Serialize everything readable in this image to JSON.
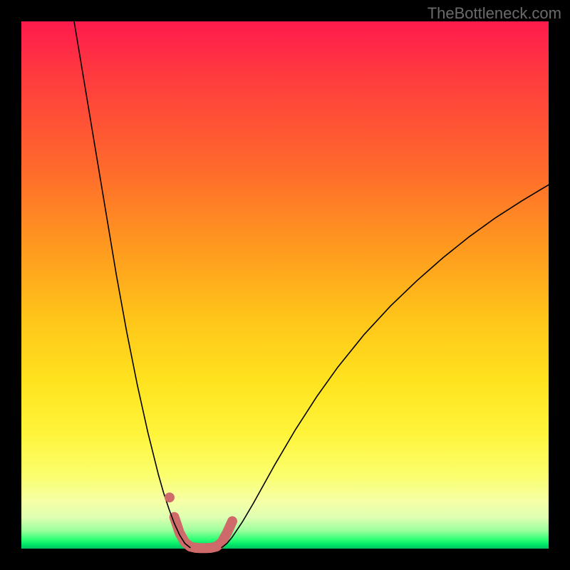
{
  "watermark": {
    "text": "TheBottleneck.com"
  },
  "chart_data": {
    "type": "line",
    "title": "",
    "xlabel": "",
    "ylabel": "",
    "xlim": [
      0,
      100
    ],
    "ylim": [
      0,
      100
    ],
    "grid": false,
    "legend": false,
    "series": [
      {
        "name": "left-curve",
        "stroke": "#000000",
        "width": 1.6,
        "x": [
          10,
          12,
          14,
          16,
          18,
          20,
          22,
          24,
          26,
          27,
          28,
          29,
          30,
          31,
          32
        ],
        "y": [
          100,
          88,
          76,
          64,
          52,
          41,
          31,
          22,
          14,
          10.5,
          7.5,
          4.8,
          2.6,
          1.0,
          0.2
        ]
      },
      {
        "name": "right-curve",
        "stroke": "#000000",
        "width": 1.6,
        "x": [
          38,
          39,
          40,
          42,
          44,
          46,
          48,
          52,
          56,
          60,
          65,
          70,
          75,
          80,
          85,
          90,
          95,
          100
        ],
        "y": [
          0.2,
          1.0,
          2.2,
          5.2,
          8.6,
          12.2,
          15.8,
          22.6,
          28.8,
          34.4,
          40.6,
          46.0,
          50.8,
          55.2,
          59.2,
          62.8,
          66.0,
          69.0
        ]
      },
      {
        "name": "trough-highlight",
        "stroke": "#cf6a6a",
        "width": 14,
        "x": [
          29,
          30,
          31,
          32,
          33,
          34,
          35,
          36,
          37,
          38,
          39,
          40
        ],
        "y": [
          6.0,
          3.0,
          1.2,
          0.4,
          0.15,
          0.1,
          0.1,
          0.15,
          0.4,
          1.2,
          3.0,
          5.2
        ]
      },
      {
        "name": "left-dot",
        "kind": "dot",
        "fill": "#cf6a6a",
        "r": 7,
        "x": [
          28.1
        ],
        "y": [
          9.7
        ]
      }
    ]
  }
}
